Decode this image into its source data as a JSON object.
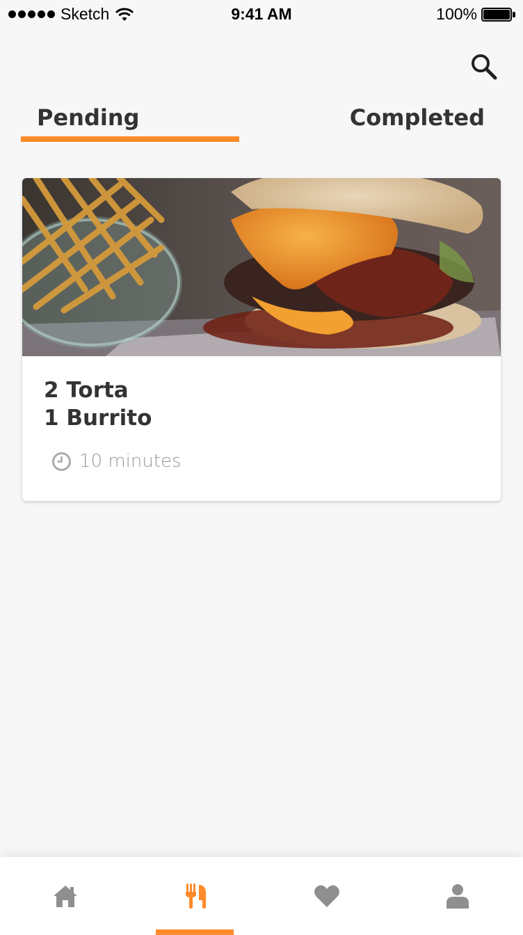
{
  "status_bar": {
    "carrier": "Sketch",
    "time": "9:41 AM",
    "battery": "100%"
  },
  "header": {
    "search_icon": "search-icon"
  },
  "tabs": [
    {
      "label": "Pending",
      "active": true
    },
    {
      "label": "Completed",
      "active": false
    }
  ],
  "orders": [
    {
      "image": "burger-and-waffle-fries-photo",
      "items": [
        "2 Torta",
        "1 Burrito"
      ],
      "eta": "10 minutes"
    }
  ],
  "bottom_nav": {
    "items": [
      {
        "icon": "home-icon",
        "active": false
      },
      {
        "icon": "restaurant-icon",
        "active": true
      },
      {
        "icon": "heart-icon",
        "active": false
      },
      {
        "icon": "user-icon",
        "active": false
      }
    ]
  },
  "colors": {
    "accent": "#ff8a2a",
    "text": "#333333",
    "muted": "#999999",
    "nav_inactive": "#8f8f8f",
    "background": "#f7f7f7"
  }
}
